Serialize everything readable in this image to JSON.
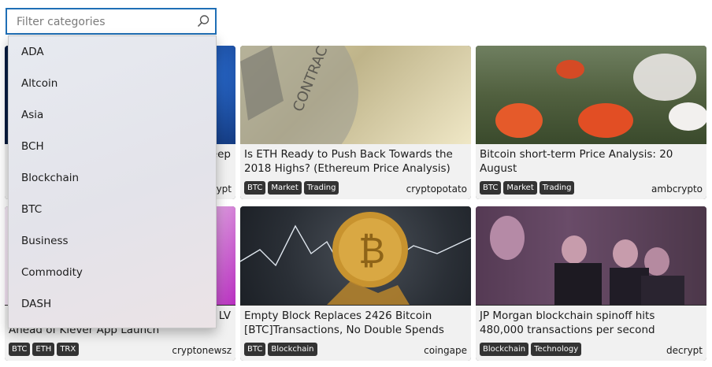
{
  "search": {
    "placeholder": "Filter categories"
  },
  "dropdown": {
    "options": [
      "ADA",
      "Altcoin",
      "Asia",
      "BCH",
      "Blockchain",
      "BTC",
      "Business",
      "Commodity",
      "DASH"
    ]
  },
  "cards": [
    {
      "title_line1": "",
      "title_line2": "Ahead of Klever App Launch",
      "title_partial": "eep",
      "tags": [
        "BTC",
        "ETH",
        "TRX"
      ],
      "source": "cryptonewsz",
      "source_partial": "rypt",
      "partial_right": "LV"
    },
    {
      "title": "Is ETH Ready to Push Back Towards the 2018 Highs? (Ethereum Price Analysis)",
      "tags": [
        "BTC",
        "Market",
        "Trading"
      ],
      "source": "cryptopotato"
    },
    {
      "title": "Bitcoin short-term Price Analysis: 20 August",
      "tags": [
        "BTC",
        "Market",
        "Trading"
      ],
      "source": "ambcrypto"
    },
    {
      "title": "Empty Block Replaces 2426 Bitcoin [BTC]Transactions, No Double Spends",
      "tags": [
        "BTC",
        "Blockchain"
      ],
      "source": "coingape"
    },
    {
      "title": "JP Morgan blockchain spinoff hits 480,000 transactions per second",
      "tags": [
        "Blockchain",
        "Technology"
      ],
      "source": "decrypt"
    }
  ],
  "image_text": "CONTRACTS"
}
